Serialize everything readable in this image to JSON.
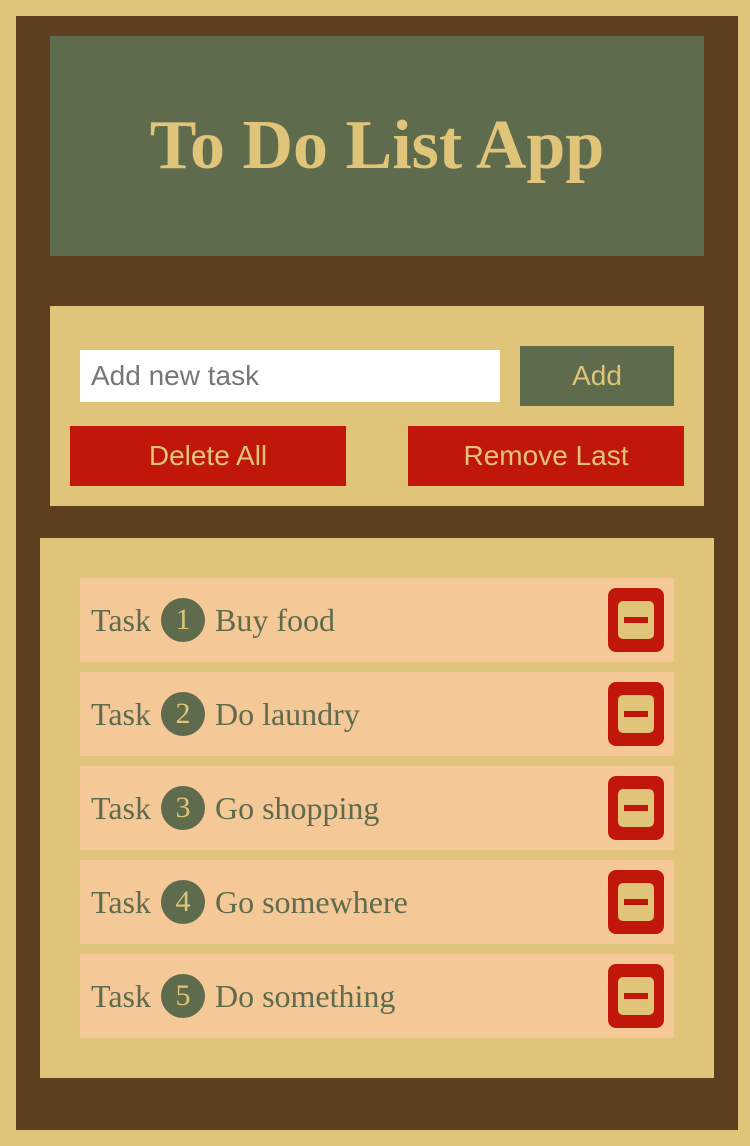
{
  "app": {
    "title": "To Do List App"
  },
  "controls": {
    "input_placeholder": "Add new task",
    "add_label": "Add",
    "delete_all_label": "Delete All",
    "remove_last_label": "Remove Last"
  },
  "tasks": [
    {
      "prefix": "Task",
      "number": "1",
      "text": "Buy food",
      "remove_icon": "minus-square-icon"
    },
    {
      "prefix": "Task",
      "number": "2",
      "text": "Do laundry",
      "remove_icon": "minus-square-icon"
    },
    {
      "prefix": "Task",
      "number": "3",
      "text": "Go shopping",
      "remove_icon": "minus-square-icon"
    },
    {
      "prefix": "Task",
      "number": "4",
      "text": "Go somewhere",
      "remove_icon": "minus-square-icon"
    },
    {
      "prefix": "Task",
      "number": "5",
      "text": "Do something",
      "remove_icon": "minus-square-icon"
    }
  ],
  "colors": {
    "background": "#dfc47a",
    "frame": "#5e3f20",
    "header": "#5e6b4c",
    "accent_red": "#c1160a",
    "task_row": "#f5c897"
  }
}
